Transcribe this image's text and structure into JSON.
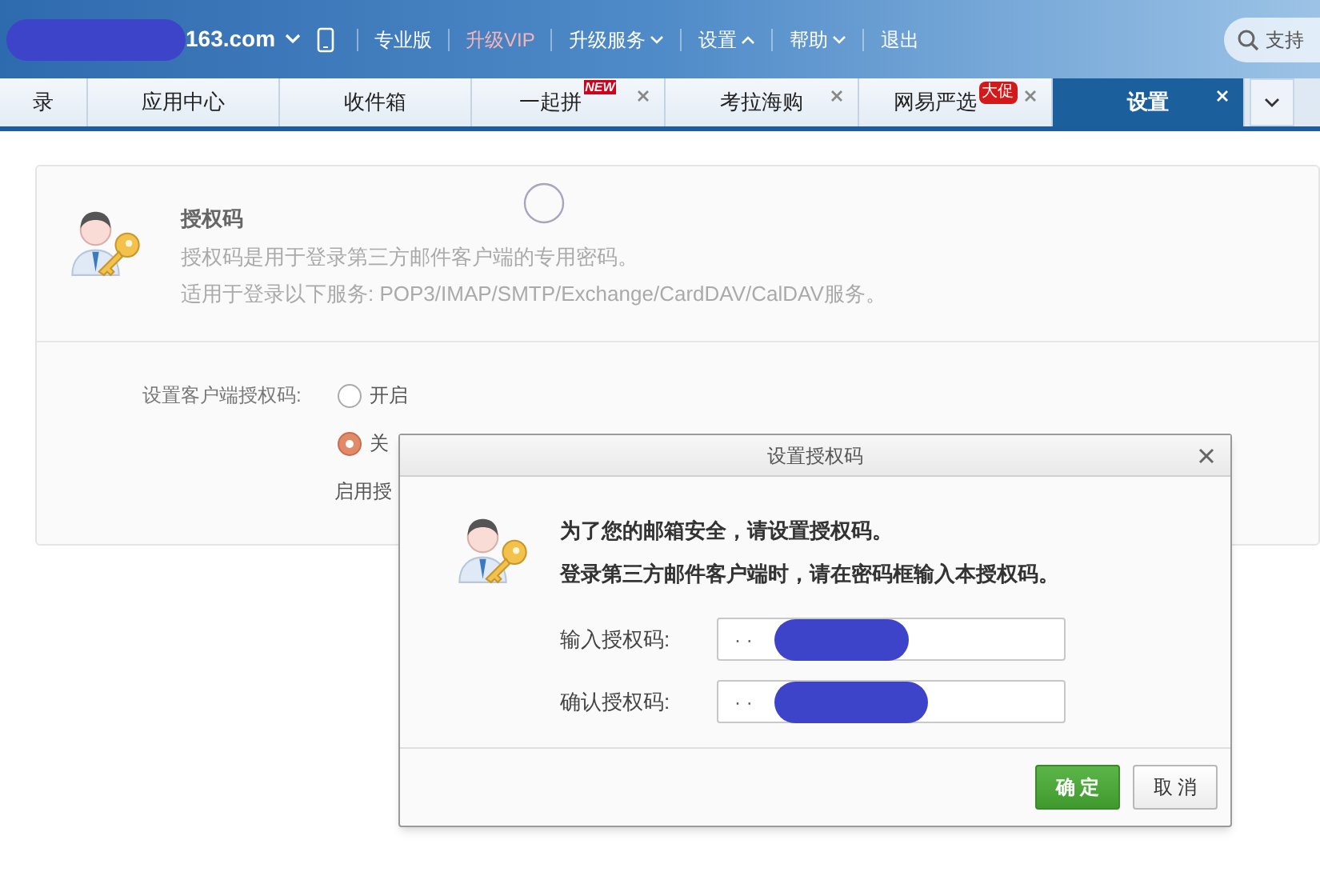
{
  "header": {
    "account": "163.com",
    "menu": [
      {
        "label": "专业版",
        "kind": "plain"
      },
      {
        "label": "升级VIP",
        "kind": "vip"
      },
      {
        "label": "升级服务",
        "kind": "dropdown",
        "expanded": false
      },
      {
        "label": "设置",
        "kind": "dropdown",
        "expanded": true
      },
      {
        "label": "帮助",
        "kind": "dropdown",
        "expanded": false
      },
      {
        "label": "退出",
        "kind": "plain"
      }
    ],
    "search": {
      "placeholder": "支持"
    }
  },
  "tabs": [
    {
      "label": "录",
      "selected": false
    },
    {
      "label": "应用中心",
      "selected": false
    },
    {
      "label": "收件箱",
      "selected": false
    },
    {
      "label": "一起拼",
      "selected": false,
      "closable": true,
      "badge": {
        "text": "NEW",
        "kind": "new"
      }
    },
    {
      "label": "考拉海购",
      "selected": false,
      "closable": true
    },
    {
      "label": "网易严选",
      "selected": false,
      "closable": true,
      "badge": {
        "text": "大促",
        "kind": "promo"
      }
    },
    {
      "label": "设置",
      "selected": true,
      "closable": true
    }
  ],
  "info": {
    "title": "授权码",
    "lines": [
      "授权码是用于登录第三方邮件客户端的专用密码。",
      "适用于登录以下服务: POP3/IMAP/SMTP/Exchange/CardDAV/CalDAV服务。"
    ]
  },
  "setting": {
    "label": "设置客户端授权码:",
    "options": [
      {
        "label": "开启",
        "selected": false
      },
      {
        "label": "关",
        "selected": true
      }
    ],
    "hint": "启用授"
  },
  "dialog": {
    "title": "设置授权码",
    "messages": [
      "为了您的邮箱安全，请设置授权码。",
      "登录第三方邮件客户端时，请在密码框输入本授权码。"
    ],
    "fields": [
      {
        "label": "输入授权码:",
        "value": "· ·"
      },
      {
        "label": "确认授权码:",
        "value": "· ·"
      }
    ],
    "buttons": [
      {
        "label": "确 定",
        "kind": "primary"
      },
      {
        "label": "取 消",
        "kind": "secondary"
      }
    ]
  }
}
